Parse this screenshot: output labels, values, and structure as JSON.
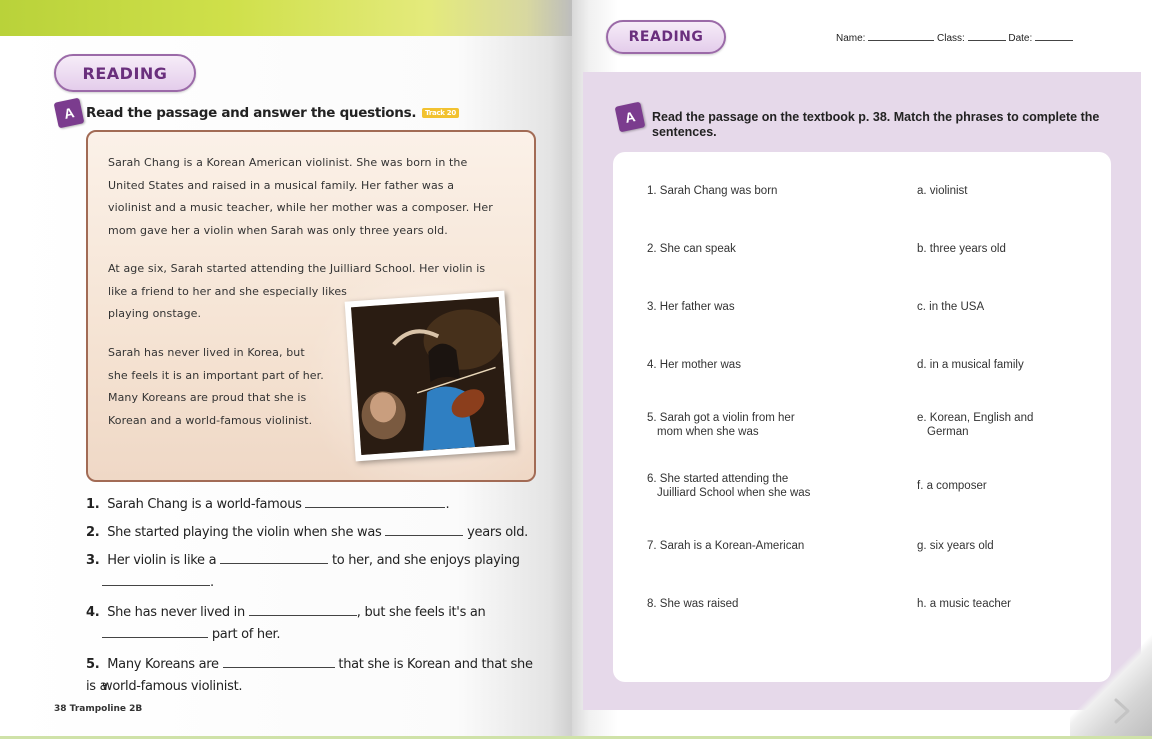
{
  "left": {
    "reading_label": "READING",
    "section_letter": "A",
    "instruction": "Read the passage and answer the questions.",
    "track_label": "Track 20",
    "passage": {
      "para1_lines": [
        "Sarah Chang is a Korean American violinist. She was born in the",
        "United States and raised in a musical family. Her father was a",
        "violinist and a music teacher, while her mother was a composer. Her",
        "mom gave her a violin when Sarah was only three years old."
      ],
      "para2_lines": [
        "At age six, Sarah started attending the Juilliard School. Her violin is",
        "like a friend to her and she especially likes",
        "playing onstage."
      ],
      "para3_lines": [
        "Sarah has never lived in Korea, but",
        "she feels it is an important part of her.",
        "Many Koreans are proud that she is",
        "Korean and a world-famous violinist."
      ]
    },
    "questions": {
      "q1_num": "1.",
      "q1_a": "Sarah Chang is a world-famous",
      "q1_b": ".",
      "q2_num": "2.",
      "q2_a": "She started playing the violin when she was",
      "q2_b": "years old.",
      "q3_num": "3.",
      "q3_a": "Her violin is like a",
      "q3_b": "to her, and she enjoys playing",
      "q3_c": ".",
      "q4_num": "4.",
      "q4_a": "She has never lived in",
      "q4_b": ", but she feels it's an",
      "q4_c": "part of her.",
      "q5_num": "5.",
      "q5_a": "Many Koreans are",
      "q5_b": "that she is Korean and that she is a",
      "q5_c": "world-famous violinist."
    },
    "footer_page": "38",
    "footer_book": "Trampoline 2B"
  },
  "right": {
    "reading_label": "READING",
    "form": {
      "name": "Name:",
      "class": "Class:",
      "date": "Date:"
    },
    "section_letter": "A",
    "instruction": "Read the passage on the textbook p. 38. Match the phrases to complete the sentences.",
    "left_phrases": [
      {
        "line1": "1. Sarah Chang was born",
        "line2": ""
      },
      {
        "line1": "2. She can speak",
        "line2": ""
      },
      {
        "line1": "3. Her father was",
        "line2": ""
      },
      {
        "line1": "4. Her mother was",
        "line2": ""
      },
      {
        "line1": "5. Sarah got a violin from her",
        "line2": "mom when she was"
      },
      {
        "line1": "6. She started attending the",
        "line2": "Juilliard School when she was"
      },
      {
        "line1": "7. Sarah is a Korean-American",
        "line2": ""
      },
      {
        "line1": "8. She was raised",
        "line2": ""
      }
    ],
    "right_phrases": [
      {
        "line1": "a. violinist",
        "line2": ""
      },
      {
        "line1": "b. three years old",
        "line2": ""
      },
      {
        "line1": "c. in the USA",
        "line2": ""
      },
      {
        "line1": "d. in a musical family",
        "line2": ""
      },
      {
        "line1": "e. Korean, English and",
        "line2": "German"
      },
      {
        "line1": "f. a composer",
        "line2": ""
      },
      {
        "line1": "g. six years old",
        "line2": ""
      },
      {
        "line1": "h. a music teacher",
        "line2": ""
      }
    ]
  },
  "colors": {
    "accent_purple": "#7b3c8e",
    "panel_lavender": "#e6d9ea",
    "passage_border": "#a26b55",
    "header_green": "#b9d23a"
  },
  "icons": {
    "next_page": "chevron-right-icon",
    "photo": "violinist-photo"
  }
}
